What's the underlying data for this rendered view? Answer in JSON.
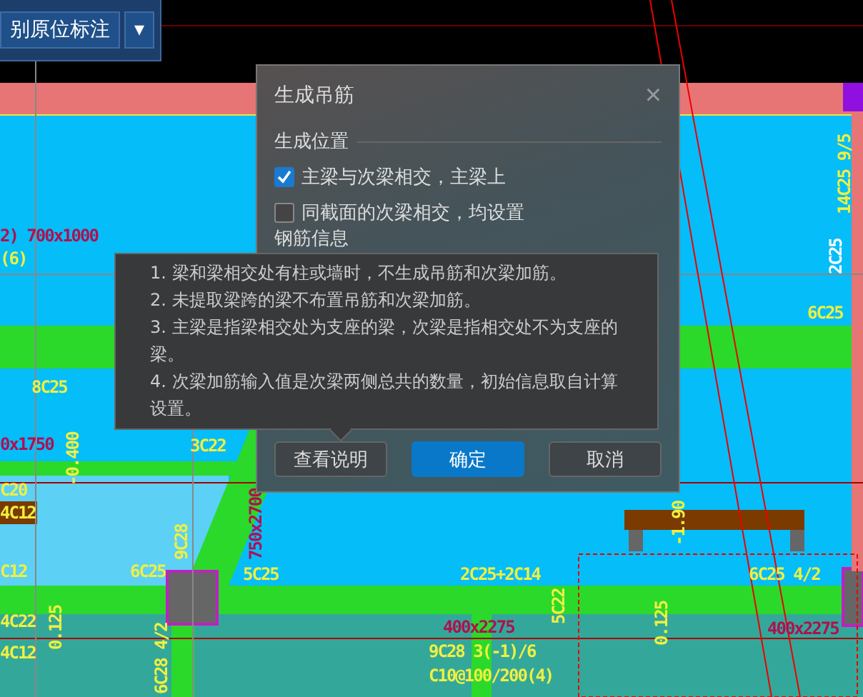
{
  "toolbar": {
    "label": "别原位标注",
    "dropdown": "▾"
  },
  "drawing_labels": [
    {
      "text": "14C25 9/5",
      "color": "#f0f040"
    },
    {
      "text": "2) 700x1000",
      "color": "#b01050"
    },
    {
      "text": "2C25",
      "color": "#ffffff"
    },
    {
      "text": "(6)",
      "color": "#f0f040"
    },
    {
      "text": "6C25",
      "color": "#f0f040"
    },
    {
      "text": "8C25",
      "color": "#f0f040"
    },
    {
      "text": "0x1750",
      "color": "#b01050"
    },
    {
      "text": "3C22",
      "color": "#f0f040"
    },
    {
      "text": "C20",
      "color": "#f0f040"
    },
    {
      "text": "-0.400",
      "color": "#f0f040"
    },
    {
      "text": "4C12",
      "color": "#f0f040"
    },
    {
      "text": "-1.90",
      "color": "#f0f040"
    },
    {
      "text": "9C28",
      "color": "#f0f040"
    },
    {
      "text": "750x2700",
      "color": "#b01050"
    },
    {
      "text": "C12",
      "color": "#f0f040"
    },
    {
      "text": "6C25",
      "color": "#f0f040"
    },
    {
      "text": "5C25",
      "color": "#f0f040"
    },
    {
      "text": "2C25+2C14",
      "color": "#f0f040"
    },
    {
      "text": "6C25 4/2",
      "color": "#f0f040"
    },
    {
      "text": "4C22",
      "color": "#f0f040"
    },
    {
      "text": "400x2275",
      "color": "#b01050"
    },
    {
      "text": "400x2275",
      "color": "#b01050"
    },
    {
      "text": "5C22",
      "color": "#f0f040"
    },
    {
      "text": "9C28 3(-1)/6",
      "color": "#f0f040"
    },
    {
      "text": "4C12",
      "color": "#f0f040"
    },
    {
      "text": "0.125",
      "color": "#f0f040"
    },
    {
      "text": "0.125",
      "color": "#f0f040"
    },
    {
      "text": "C10@100/200(4)",
      "color": "#f0f040"
    },
    {
      "text": "6C28 4/2",
      "color": "#f0f040"
    }
  ],
  "dialog": {
    "title": "生成吊筋",
    "close": "×",
    "section": "生成位置",
    "options": [
      {
        "label": "主梁与次梁相交，主梁上",
        "checked": true
      },
      {
        "label": "同截面的次梁相交，均设置",
        "checked": false
      }
    ],
    "section_2": "钢筋信息",
    "buttons": [
      {
        "label": "查看说明",
        "kind": "secondary"
      },
      {
        "label": "确定",
        "kind": "primary"
      },
      {
        "label": "取消",
        "kind": "secondary"
      }
    ]
  },
  "help_tooltip": {
    "lines": [
      "1. 梁和梁相交处有柱或墙时，不生成吊筋和次梁加筋。",
      "2. 未提取梁跨的梁不布置吊筋和次梁加筋。",
      "3. 主梁是指梁相交处为支座的梁，次梁是指相交处不为支座的梁。",
      "4. 次梁加筋输入值是次梁两侧总共的数量，初始信息取自计算设置。"
    ]
  }
}
